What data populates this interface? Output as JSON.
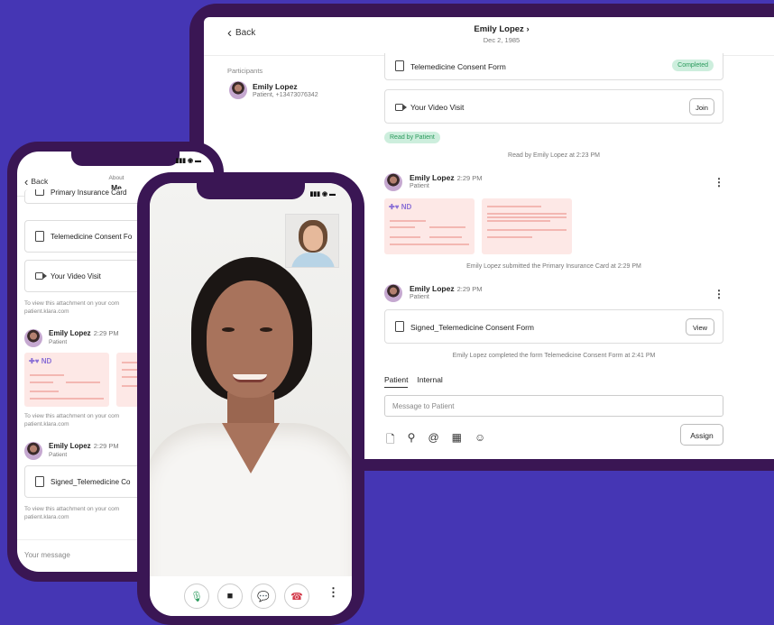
{
  "tablet": {
    "back_label": "Back",
    "patient_name": "Emily Lopez",
    "patient_dob": "Dec 2, 1985",
    "participants_label": "Participants",
    "participant_name": "Emily Lopez",
    "participant_meta": "Patient, +13473076342",
    "consent_form_label": "Telemedicine Consent Form",
    "completed_badge": "Completed",
    "video_visit_label": "Your Video Visit",
    "join_label": "Join",
    "read_badge": "Read by Patient",
    "read_note": "Read by Emily Lopez at 2:23 PM",
    "messages": [
      {
        "name": "Emily Lopez",
        "time": "2:29 PM",
        "role": "Patient"
      },
      {
        "name": "Emily Lopez",
        "time": "2:29 PM",
        "role": "Patient"
      }
    ],
    "thumb_label": "ND",
    "insurance_note": "Emily Lopez submitted the Primary Insurance Card at 2:29 PM",
    "signed_form_label": "Signed_Telemedicine Consent Form",
    "view_label": "View",
    "completed_note": "Emily Lopez completed the form Telemedicine Consent Form at 2:41 PM",
    "tab_patient": "Patient",
    "tab_internal": "Internal",
    "message_placeholder": "Message to Patient",
    "assign_label": "Assign",
    "toolbar_icons": [
      "document-icon",
      "paperclip-icon",
      "at-icon",
      "calendar-icon",
      "emoji-icon"
    ]
  },
  "phone_left": {
    "back_label": "Back",
    "about_label": "About",
    "about_value": "Me",
    "insurance_card_label": "Primary Insurance Card",
    "consent_form_label": "Telemedicine Consent Fo",
    "video_visit_label": "Your Video Visit",
    "hint_line1": "To view this attachment on your com",
    "hint_line2": "patient.klara.com",
    "messages": [
      {
        "name": "Emily Lopez",
        "time": "2:29 PM",
        "role": "Patient"
      },
      {
        "name": "Emily Lopez",
        "time": "2:29 PM",
        "role": "Patient"
      }
    ],
    "thumb_label": "ND",
    "signed_form_label": "Signed_Telemedicine Co",
    "message_placeholder": "Your message"
  },
  "phone_video": {
    "control_icons": [
      "microphone-icon",
      "camera-icon",
      "chat-icon",
      "hangup-icon"
    ],
    "more_label": "⋮"
  },
  "colors": {
    "background": "#4536b4",
    "device_frame": "#3a1654",
    "success": "#2a9a5c",
    "hangup": "#d33a4a",
    "mic": "#2a9a5c"
  }
}
